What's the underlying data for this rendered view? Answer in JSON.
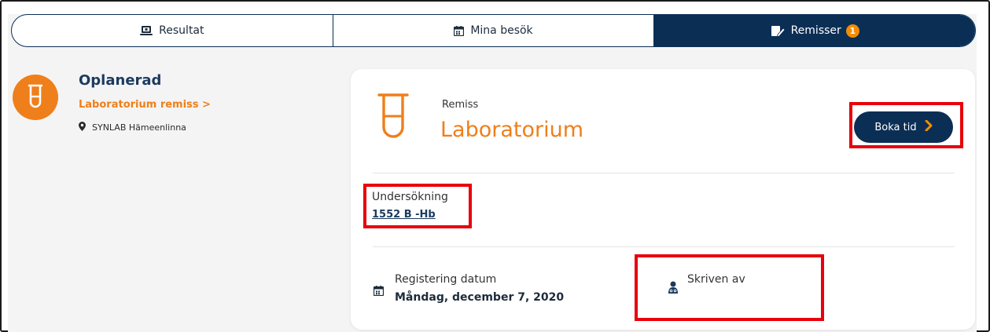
{
  "tabs": [
    {
      "label": "Resultat",
      "icon": "laptop-icon",
      "active": false
    },
    {
      "label": "Mina besök",
      "icon": "calendar-icon",
      "active": false
    },
    {
      "label": "Remisser",
      "icon": "edit-document-icon",
      "active": true,
      "badge": "1"
    }
  ],
  "summary": {
    "status": "Oplanerad",
    "link_label": "Laboratorium remiss >",
    "location": "SYNLAB Hämeenlinna"
  },
  "card": {
    "kicker": "Remiss",
    "title": "Laboratorium",
    "book_label": "Boka tid",
    "examination_label": "Undersökning",
    "examination_value": "1552 B -Hb",
    "registered_label": "Registering datum",
    "registered_value": "Måndag, december 7, 2020",
    "author_label": "Skriven av"
  },
  "colors": {
    "navy": "#0b2e55",
    "orange": "#ef7f1a",
    "highlight": "#e8000b"
  }
}
